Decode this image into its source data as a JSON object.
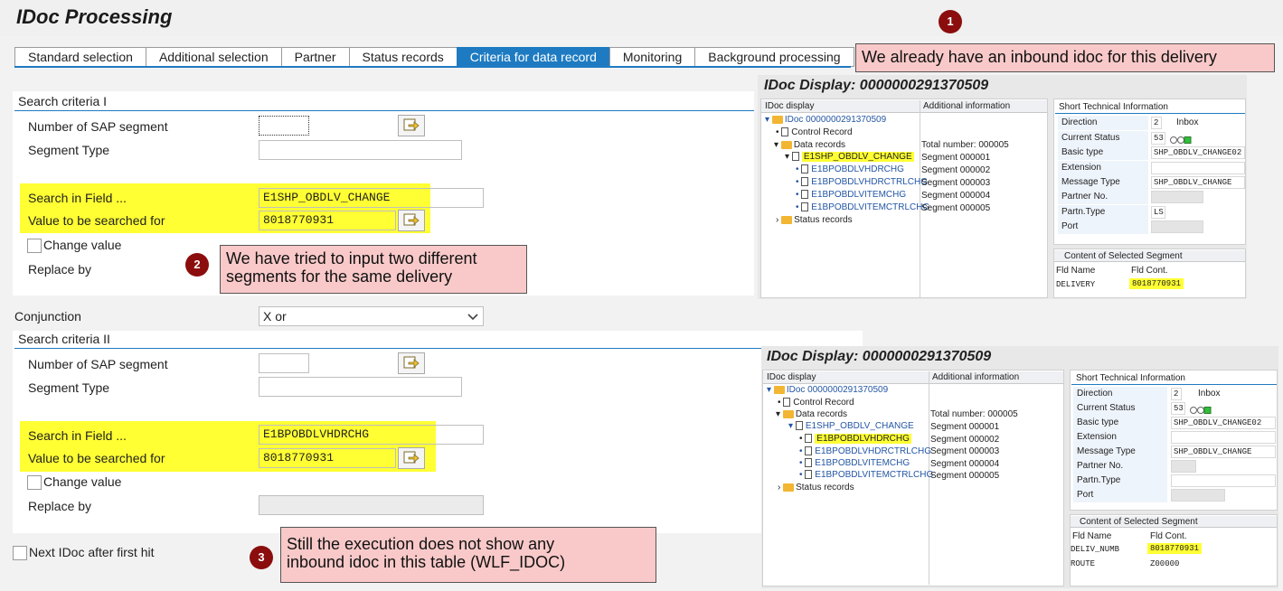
{
  "app": {
    "title": "IDoc Processing"
  },
  "tabs": [
    {
      "label": "Standard selection"
    },
    {
      "label": "Additional selection"
    },
    {
      "label": "Partner"
    },
    {
      "label": "Status records"
    },
    {
      "label": "Criteria for data record",
      "active": true
    },
    {
      "label": "Monitoring"
    },
    {
      "label": "Background processing"
    }
  ],
  "criteria1": {
    "title": "Search criteria I",
    "num_segment_label": "Number of SAP segment",
    "num_segment_value": "",
    "segment_type_label": "Segment Type",
    "segment_type_value": "",
    "search_field_label": "Search in Field ...",
    "search_field_value": "E1SHP_OBDLV_CHANGE",
    "search_value_label": "Value to be searched for",
    "search_value_value": "8018770931",
    "change_value_label": "Change value",
    "replace_by_label": "Replace by"
  },
  "conjunction": {
    "label": "Conjunction",
    "value": "X or"
  },
  "criteria2": {
    "title": "Search criteria II",
    "num_segment_label": "Number of SAP segment",
    "segment_type_label": "Segment Type",
    "search_field_label": "Search in Field ...",
    "search_field_value": "E1BPOBDLVHDRCHG",
    "search_value_label": "Value to be searched for",
    "search_value_value": "8018770931",
    "change_value_label": "Change value",
    "replace_by_label": "Replace by"
  },
  "next_idoc": {
    "label": "Next IDoc after first hit"
  },
  "callouts": [
    {
      "num": "1",
      "text": "We already have an inbound idoc for this delivery"
    },
    {
      "num": "2",
      "text_line1": "We have tried to input two different",
      "text_line2": "segments for the same delivery"
    },
    {
      "num": "3",
      "text_line1": "Still the execution does not show any",
      "text_line2": "inbound idoc in this table (WLF_IDOC)"
    }
  ],
  "idoc1": {
    "title": "IDoc Display: 0000000291370509",
    "col_idoc": "IDoc display",
    "col_info": "Additional information",
    "root": "IDoc 0000000291370509",
    "control": "Control Record",
    "data_records": "Data records",
    "total": "Total number: 000005",
    "segments": [
      {
        "name": "E1SHP_OBDLV_CHANGE",
        "info": "Segment 000001"
      },
      {
        "name": "E1BPOBDLVHDRCHG",
        "info": "Segment 000002"
      },
      {
        "name": "E1BPOBDLVHDRCTRLCHG",
        "info": "Segment 000003"
      },
      {
        "name": "E1BPOBDLVITEMCHG",
        "info": "Segment 000004"
      },
      {
        "name": "E1BPOBDLVITEMCTRLCHG",
        "info": "Segment 000005"
      }
    ],
    "status_records": "Status records",
    "sti_title": "Short Technical Information",
    "sti": [
      {
        "label": "Direction",
        "value": "2",
        "extra": "Inbox"
      },
      {
        "label": "Current Status",
        "value": "53",
        "extra": ""
      },
      {
        "label": "Basic type",
        "value": "SHP_OBDLV_CHANGE02"
      },
      {
        "label": "Extension",
        "value": ""
      },
      {
        "label": "Message Type",
        "value": "SHP_OBDLV_CHANGE"
      },
      {
        "label": "Partner No.",
        "value": ""
      },
      {
        "label": "Partn.Type",
        "value": "LS"
      },
      {
        "label": "Port",
        "value": ""
      }
    ],
    "content_title": "Content of Selected Segment",
    "fld_name_head": "Fld Name",
    "fld_cont_head": "Fld Cont.",
    "fields": [
      {
        "name": "DELIVERY",
        "value": "8018770931"
      }
    ]
  },
  "idoc2": {
    "title": "IDoc Display: 0000000291370509",
    "col_idoc": "IDoc display",
    "col_info": "Additional information",
    "root": "IDoc 0000000291370509",
    "control": "Control Record",
    "data_records": "Data records",
    "total": "Total number: 000005",
    "segments": [
      {
        "name": "E1SHP_OBDLV_CHANGE",
        "info": "Segment 000001"
      },
      {
        "name": "E1BPOBDLVHDRCHG",
        "info": "Segment 000002"
      },
      {
        "name": "E1BPOBDLVHDRCTRLCHG",
        "info": "Segment 000003"
      },
      {
        "name": "E1BPOBDLVITEMCHG",
        "info": "Segment 000004"
      },
      {
        "name": "E1BPOBDLVITEMCTRLCHG",
        "info": "Segment 000005"
      }
    ],
    "status_records": "Status records",
    "sti_title": "Short Technical Information",
    "sti": [
      {
        "label": "Direction",
        "value": "2",
        "extra": "Inbox"
      },
      {
        "label": "Current Status",
        "value": "53",
        "extra": ""
      },
      {
        "label": "Basic type",
        "value": "SHP_OBDLV_CHANGE02"
      },
      {
        "label": "Extension",
        "value": ""
      },
      {
        "label": "Message Type",
        "value": "SHP_OBDLV_CHANGE"
      },
      {
        "label": "Partner No.",
        "value": ""
      },
      {
        "label": "Partn.Type",
        "value": ""
      },
      {
        "label": "Port",
        "value": ""
      }
    ],
    "content_title": "Content of Selected Segment",
    "fld_name_head": "Fld Name",
    "fld_cont_head": "Fld Cont.",
    "fields": [
      {
        "name": "DELIV_NUMB",
        "value": "8018770931"
      },
      {
        "name": "ROUTE",
        "value": "Z00000"
      }
    ]
  },
  "colors": {
    "accent": "#1e7bc2",
    "highlight": "#ffff33",
    "callout_bg": "#f9c9c9",
    "badge": "#8b0d0d"
  }
}
